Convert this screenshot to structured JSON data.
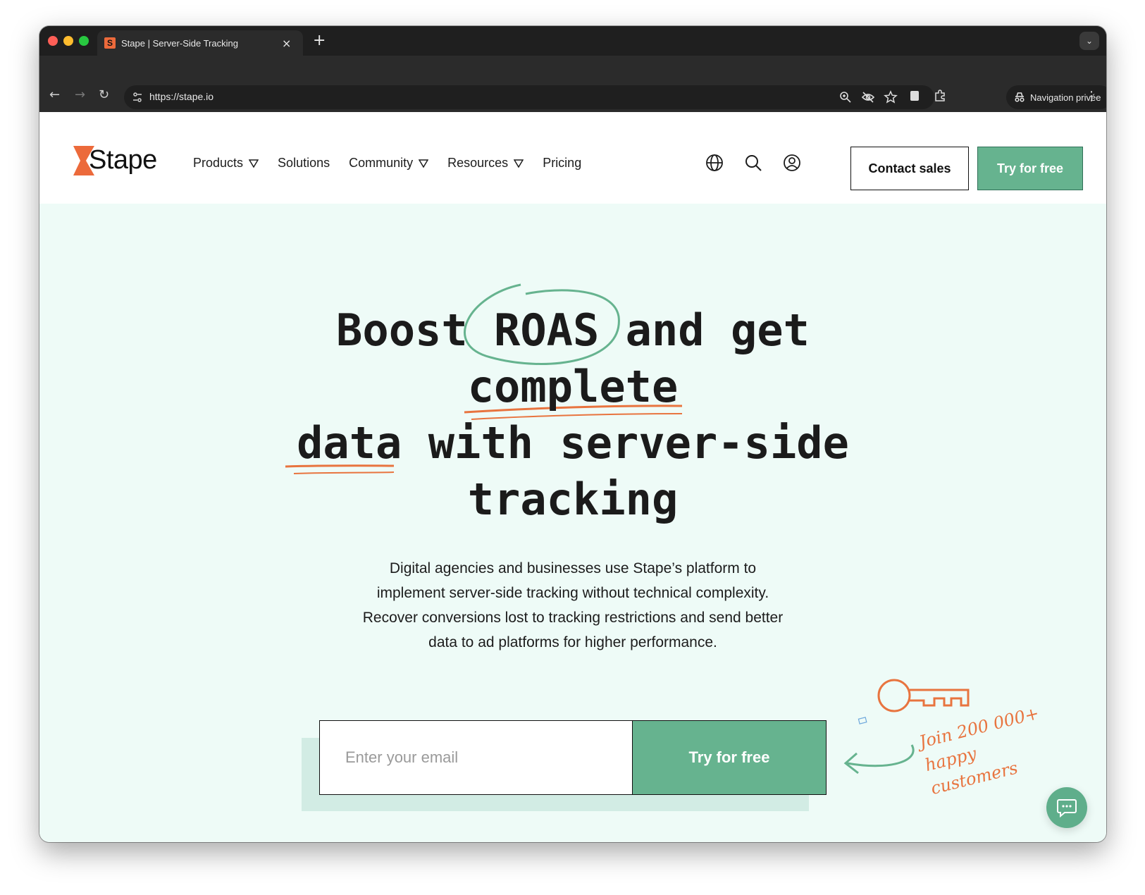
{
  "browser": {
    "tab_title": "Stape | Server-Side Tracking",
    "favicon_letter": "S",
    "url": "https://stape.io",
    "incognito_label": "Navigation privée"
  },
  "header": {
    "logo_text": "Stape",
    "nav": [
      {
        "label": "Products",
        "has_dropdown": true
      },
      {
        "label": "Solutions",
        "has_dropdown": false
      },
      {
        "label": "Community",
        "has_dropdown": true
      },
      {
        "label": "Resources",
        "has_dropdown": true
      },
      {
        "label": "Pricing",
        "has_dropdown": false
      }
    ],
    "icons": [
      "globe-icon",
      "search-icon",
      "user-icon"
    ],
    "contact_label": "Contact sales",
    "try_label": "Try for free"
  },
  "hero": {
    "headline": {
      "w1": "Boost",
      "w2": "ROAS",
      "w3": "and get",
      "w4": "complete",
      "w5": "data",
      "w6": "with server-side",
      "w7": "tracking"
    },
    "subtitle": "Digital agencies and businesses use Stape’s platform to implement server-side tracking without technical complexity. Recover conversions lost to tracking restrictions and send better data to ad platforms for higher performance.",
    "email_placeholder": "Enter your email",
    "try_label": "Try for free",
    "join_line1": "Join 200 000+",
    "join_line2": "happy customers"
  },
  "colors": {
    "accent_green": "#66b38f",
    "accent_orange": "#e8743f",
    "hero_bg": "#eefbf7"
  }
}
